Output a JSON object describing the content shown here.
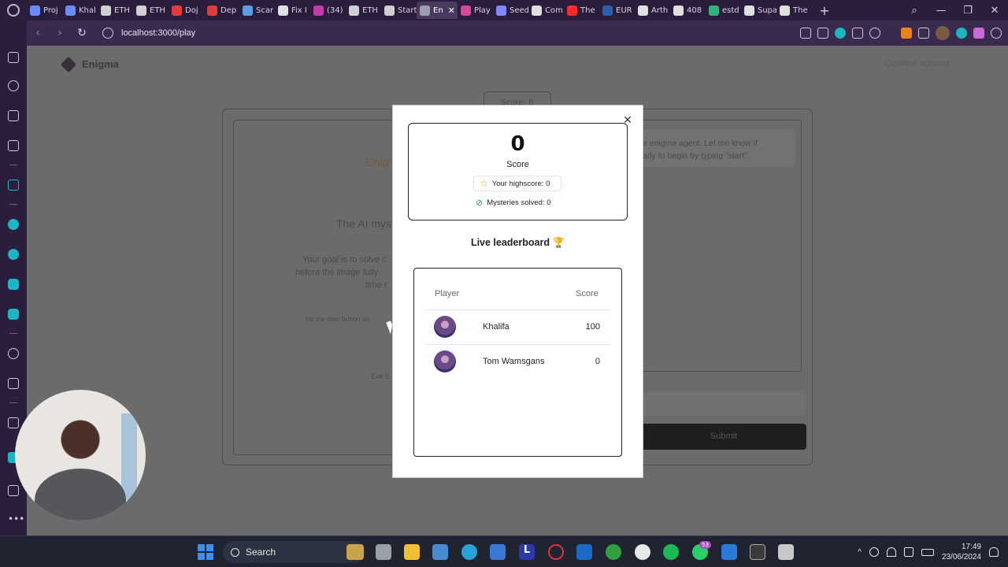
{
  "browser": {
    "tabs": [
      {
        "label": "Proj",
        "color": "#6a8cff"
      },
      {
        "label": "Khal",
        "color": "#6a8cff"
      },
      {
        "label": "ETH",
        "color": "#d0d0d0"
      },
      {
        "label": "ETH",
        "color": "#d0d0d0"
      },
      {
        "label": "Doj",
        "color": "#e23b3b"
      },
      {
        "label": "Dep",
        "color": "#e23b3b"
      },
      {
        "label": "Scar",
        "color": "#5aa0e0"
      },
      {
        "label": "Fix I",
        "color": "#e0e0e0"
      },
      {
        "label": "(34)",
        "color": "#c43bb0"
      },
      {
        "label": "ETH",
        "color": "#d0d0d0"
      },
      {
        "label": "Start",
        "color": "#d0d0d0"
      },
      {
        "label": "En",
        "color": "#9aa0b0",
        "active": true
      },
      {
        "label": "Play",
        "color": "#d8479a"
      },
      {
        "label": "Seed",
        "color": "#8088ff"
      },
      {
        "label": "Com",
        "color": "#e0e0e0"
      },
      {
        "label": "The",
        "color": "#ff2b2b"
      },
      {
        "label": "EUR",
        "color": "#2b5fb0"
      },
      {
        "label": "Arth",
        "color": "#e0e0e0"
      },
      {
        "label": "408",
        "color": "#e0e0e0"
      },
      {
        "label": "estd",
        "color": "#34b27b"
      },
      {
        "label": "Supa",
        "color": "#e0e0e0"
      },
      {
        "label": "The",
        "color": "#e0e0e0"
      }
    ],
    "url": "localhost:3000/play"
  },
  "page": {
    "site_name": "Enigma",
    "connect_label": "Connect account",
    "score_pill": "Score: 0",
    "bg_game_title": "Enig",
    "bg_heading": "The AI mys",
    "bg_para1": "Your goal is to solve c",
    "bg_para2": "before the image fully",
    "bg_para3": "time r",
    "bg_hint": "Hit the start button on",
    "bg_exit": "Exit S",
    "chat_line1": "e enigma agent. Let me know if",
    "chat_line2": "ady to begin by typing \"start\".",
    "submit_label": "Submit"
  },
  "modal": {
    "score_value": "0",
    "score_label": "Score",
    "highscore": "Your highscore: 0",
    "mysteries": "Mysteries solved: 0",
    "leaderboard_title": "Live leaderboard",
    "col_player": "Player",
    "col_score": "Score",
    "rows": [
      {
        "name": "Khalifa",
        "score": "100"
      },
      {
        "name": "Tom Wamsgans",
        "score": "0"
      }
    ]
  },
  "taskbar": {
    "search_label": "Search",
    "notification_count": "53",
    "time": "17:49",
    "date": "23/06/2024"
  }
}
